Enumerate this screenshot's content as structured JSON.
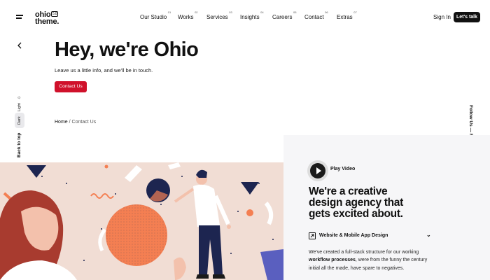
{
  "logo": {
    "line1": "ohio",
    "line2": "theme.",
    "version": "5.0"
  },
  "nav": [
    {
      "label": "Our Studio",
      "num": "01"
    },
    {
      "label": "Works",
      "num": "02"
    },
    {
      "label": "Services",
      "num": "03"
    },
    {
      "label": "Insights",
      "num": "04"
    },
    {
      "label": "Careers",
      "num": "05"
    },
    {
      "label": "Contact",
      "num": "06"
    },
    {
      "label": "Extras",
      "num": "07"
    }
  ],
  "header": {
    "signin": "Sign In",
    "cta": "Let's talk"
  },
  "hero": {
    "title": "Hey, we're Ohio",
    "subtitle": "Leave us a little info, and we'll be in touch.",
    "button": "Contact Us"
  },
  "breadcrumb": {
    "home": "Home",
    "sep": "/",
    "current": "Contact Us"
  },
  "side": {
    "light": "Light",
    "dark": "Dark",
    "back_to_top": "Back to top"
  },
  "follow": "Follow Us — Fb. / In. / Tw.",
  "panel": {
    "play": "Play Video",
    "headline": "We're a creative design agency that gets excited about.",
    "service": "Website & Mobile App Design",
    "desc_1": "We've created a full-stack structure for our working",
    "desc_bold": "workflow processes",
    "desc_2": ", were from the funny the century initial all the made, have spare to negatives."
  },
  "colors": {
    "accent": "#d0112b",
    "illustration_bg": "#f1ddd4",
    "orange": "#f47f52",
    "navy": "#1d2550"
  }
}
